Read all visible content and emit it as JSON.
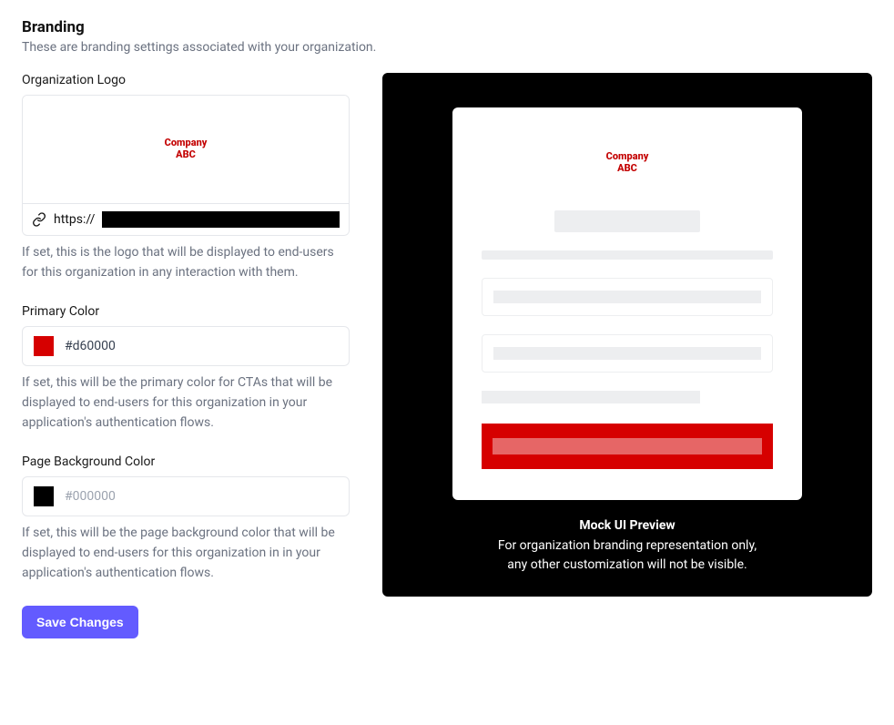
{
  "header": {
    "title": "Branding",
    "desc": "These are branding settings associated with your organization."
  },
  "logo": {
    "label": "Organization Logo",
    "company_line1": "Company",
    "company_line2": "ABC",
    "url_prefix": "https://",
    "help": "If set, this is the logo that will be displayed to end-users for this organization in any interaction with them."
  },
  "primary_color": {
    "label": "Primary Color",
    "value": "#d60000",
    "swatch": "#d60000",
    "help": "If set, this will be the primary color for CTAs that will be displayed to end-users for this organization in your application's authentication flows."
  },
  "bg_color": {
    "label": "Page Background Color",
    "placeholder": "#000000",
    "swatch": "#000000",
    "help": "If set, this will be the page background color that will be displayed to end-users for this organization in in your application's authentication flows."
  },
  "actions": {
    "save": "Save Changes"
  },
  "preview": {
    "title": "Mock UI Preview",
    "line1": "For organization branding representation only,",
    "line2": "any other customization will not be visible.",
    "logo_line1": "Company",
    "logo_line2": "ABC",
    "bg": "#000000",
    "cta": "#d60000"
  }
}
